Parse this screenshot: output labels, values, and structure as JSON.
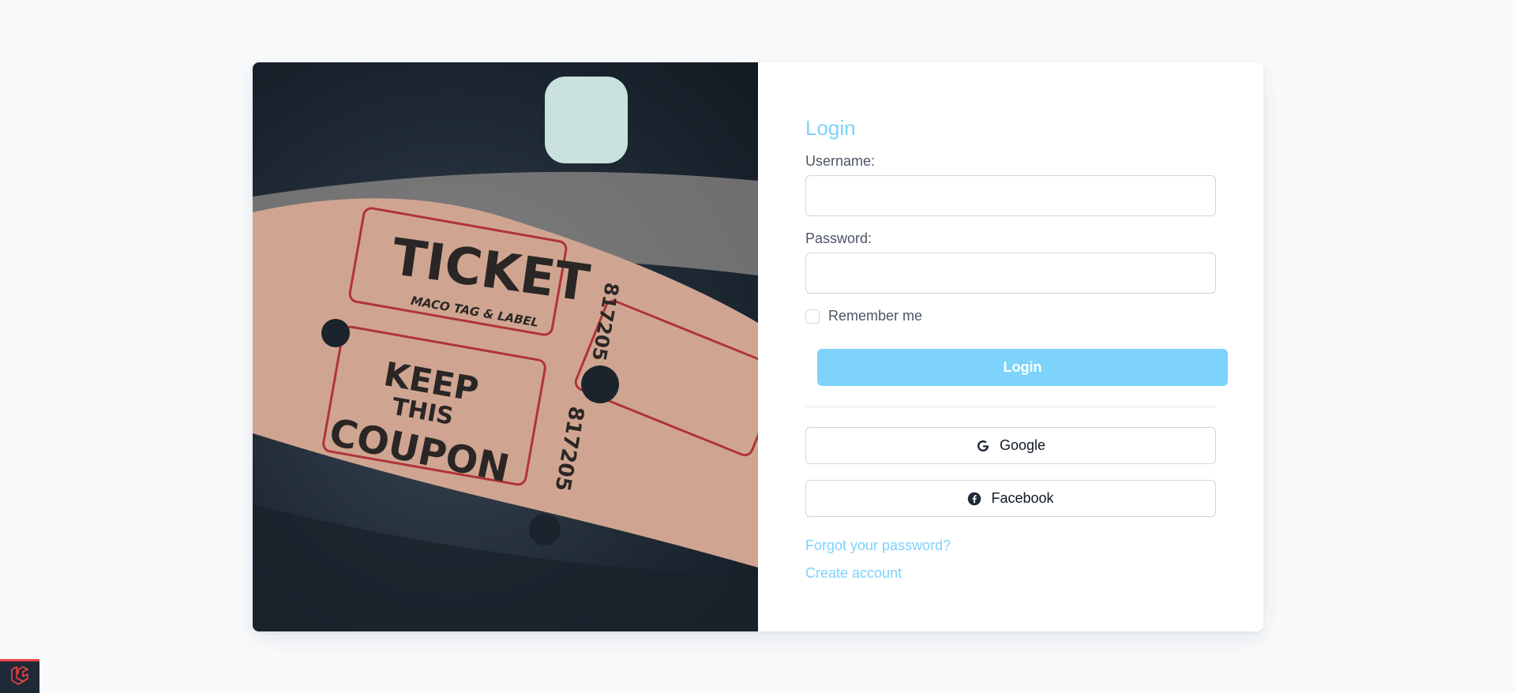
{
  "login": {
    "title": "Login",
    "username_label": "Username:",
    "username_value": "",
    "password_label": "Password:",
    "password_value": "",
    "remember_label": "Remember me",
    "remember_checked": false,
    "submit_label": "Login"
  },
  "social": {
    "google_label": "Google",
    "google_icon": "google-icon",
    "facebook_label": "Facebook",
    "facebook_icon": "facebook-icon"
  },
  "links": {
    "forgot": "Forgot your password?",
    "create": "Create account"
  },
  "photo": {
    "subject": "ticket-roll",
    "ticket_word": "TICKET",
    "maker": "MACO TAG & LABEL",
    "keep_line1": "KEEP",
    "keep_line2": "THIS",
    "keep_line3": "COUPON",
    "serial": "817205"
  },
  "colors": {
    "accent": "#7dd3fc",
    "page_bg": "#f8fafc",
    "badge_bg": "#1f2937",
    "badge_accent": "#ef4444"
  },
  "badge": {
    "icon": "laravel-icon"
  }
}
